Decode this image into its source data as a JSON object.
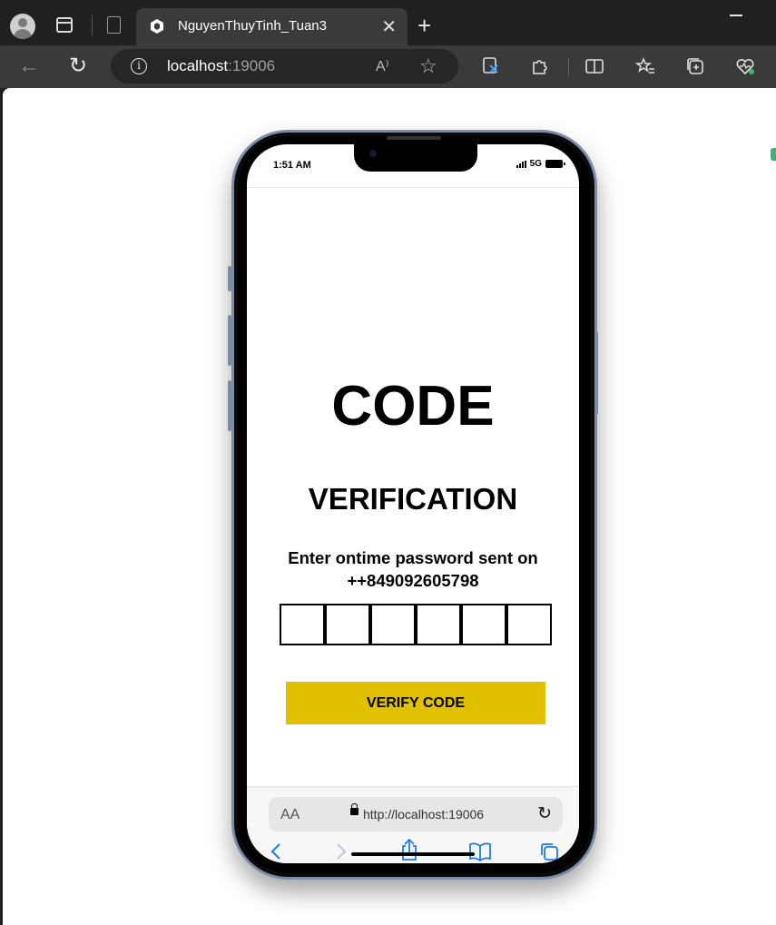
{
  "browser": {
    "tab_title": "NguyenThuyTinh_Tuan3",
    "close_glyph": "✕",
    "new_tab_glyph": "+",
    "address_host": "localhost",
    "address_port": ":19006",
    "read_aloud_glyph": "A⁾"
  },
  "phone": {
    "status_time": "1:51 AM",
    "network": "5G"
  },
  "app": {
    "title": "CODE",
    "subtitle": "VERIFICATION",
    "instruction": "Enter ontime password sent on ++849092605798",
    "otp_digits": [
      "",
      "",
      "",
      "",
      "",
      ""
    ],
    "verify_label": "VERIFY CODE",
    "accent_color": "#e1c000"
  },
  "safari": {
    "aa_label": "AA",
    "url": "http://localhost:19006"
  },
  "icons": [
    "profile-icon",
    "tabs-icon",
    "page-icon",
    "favicon",
    "back-icon",
    "reload-icon",
    "info-icon",
    "read-aloud-icon",
    "favorite-star-icon",
    "extension-icon",
    "split-screen-icon",
    "favorites-icon",
    "collections-icon",
    "health-icon"
  ]
}
